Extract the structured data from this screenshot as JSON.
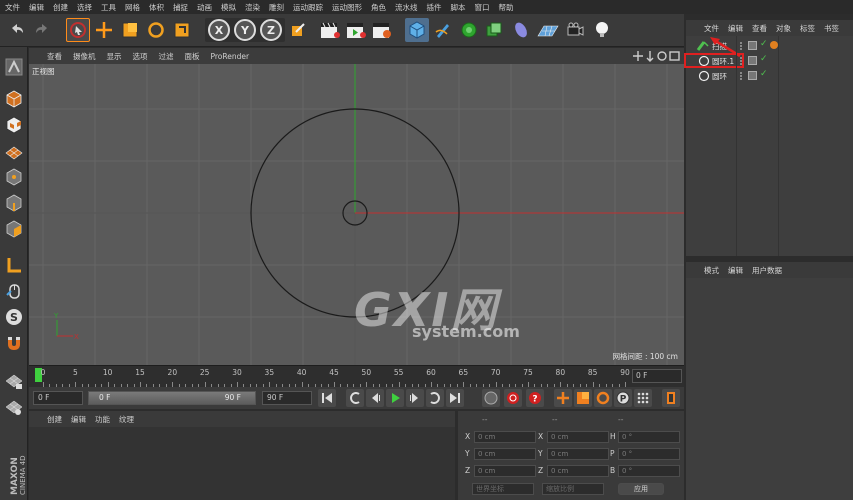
{
  "menubar": [
    "文件",
    "编辑",
    "创建",
    "选择",
    "工具",
    "网格",
    "体积",
    "捕捉",
    "动画",
    "模拟",
    "渲染",
    "雕刻",
    "运动跟踪",
    "运动图形",
    "角色",
    "流水线",
    "插件",
    "脚本",
    "窗口",
    "帮助"
  ],
  "toolbar": {
    "axis_x": "X",
    "axis_y": "Y",
    "axis_z": "Z"
  },
  "viewport": {
    "menu": [
      "查看",
      "摄像机",
      "显示",
      "选项",
      "过滤",
      "面板",
      "ProRender"
    ],
    "label": "正视图",
    "grid_info": "网格间距 : 100 cm"
  },
  "timeline": {
    "ticks": [
      "0",
      "5",
      "10",
      "15",
      "20",
      "25",
      "30",
      "35",
      "40",
      "45",
      "50",
      "55",
      "60",
      "65",
      "70",
      "75",
      "80",
      "85",
      "90"
    ],
    "current_frame": "0 F"
  },
  "transport": {
    "start": "0 F",
    "range_start": "0 F",
    "range_end": "90 F",
    "end": "90 F"
  },
  "material": {
    "menu": [
      "创建",
      "编辑",
      "功能",
      "纹理"
    ]
  },
  "coords": {
    "pos": {
      "label_x": "X",
      "label_y": "Y",
      "label_z": "Z",
      "x": "0 cm",
      "y": "0 cm",
      "z": "0 cm"
    },
    "size": {
      "label_x": "X",
      "label_y": "Y",
      "label_z": "Z",
      "x": "0 cm",
      "y": "0 cm",
      "z": "0 cm"
    },
    "rot": {
      "label_h": "H",
      "label_p": "P",
      "label_b": "B",
      "h": "0 °",
      "p": "0 °",
      "b": "0 °"
    },
    "headers": [
      "--",
      "--",
      "--"
    ],
    "mode_select": "世界坐标",
    "scale_select": "缩放比例",
    "apply": "应用"
  },
  "objects": {
    "menu": [
      "文件",
      "编辑",
      "查看",
      "对象",
      "标签",
      "书签"
    ],
    "items": [
      {
        "name": "扫描"
      },
      {
        "name": "圆环.1"
      },
      {
        "name": "圆环"
      }
    ]
  },
  "attributes": {
    "menu": [
      "模式",
      "编辑",
      "用户数据"
    ]
  },
  "watermark": {
    "main": "GXI网",
    "sub": "system.com"
  },
  "brand": "MAXON CINEMA 4D",
  "colors": {
    "accent": "#ff8c1a",
    "highlight_box": "#e02020",
    "y_axis": "#2fa52f",
    "x_axis": "#c03030"
  }
}
